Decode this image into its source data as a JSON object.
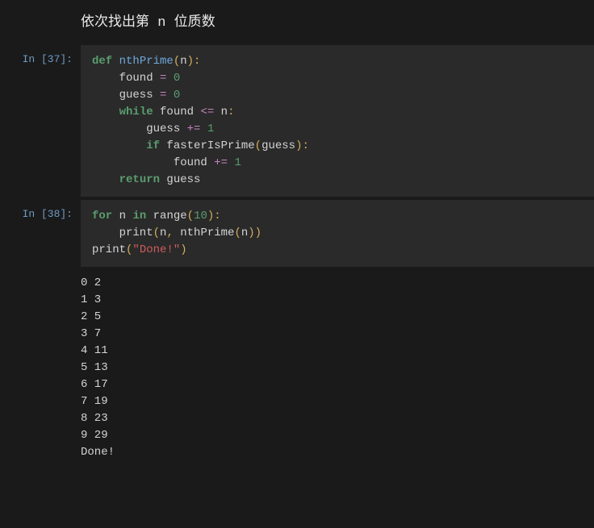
{
  "heading": "依次找出第 n 位质数",
  "cells": [
    {
      "prompt": "In [37]:",
      "code_tokens": [
        {
          "t": "def ",
          "c": "kw"
        },
        {
          "t": "nthPrime",
          "c": "fn"
        },
        {
          "t": "(",
          "c": "paren"
        },
        {
          "t": "n",
          "c": ""
        },
        {
          "t": "):",
          "c": "paren"
        },
        {
          "t": "\n",
          "c": ""
        },
        {
          "t": "    found ",
          "c": ""
        },
        {
          "t": "= ",
          "c": "op"
        },
        {
          "t": "0",
          "c": "num"
        },
        {
          "t": "\n",
          "c": ""
        },
        {
          "t": "    guess ",
          "c": ""
        },
        {
          "t": "= ",
          "c": "op"
        },
        {
          "t": "0",
          "c": "num"
        },
        {
          "t": "\n",
          "c": ""
        },
        {
          "t": "    ",
          "c": ""
        },
        {
          "t": "while",
          "c": "kw"
        },
        {
          "t": " found ",
          "c": ""
        },
        {
          "t": "<= ",
          "c": "op"
        },
        {
          "t": "n",
          "c": ""
        },
        {
          "t": ":",
          "c": "paren"
        },
        {
          "t": "\n",
          "c": ""
        },
        {
          "t": "        guess ",
          "c": ""
        },
        {
          "t": "+= ",
          "c": "op"
        },
        {
          "t": "1",
          "c": "num"
        },
        {
          "t": "\n",
          "c": ""
        },
        {
          "t": "        ",
          "c": ""
        },
        {
          "t": "if",
          "c": "kw"
        },
        {
          "t": " fasterIsPrime",
          "c": ""
        },
        {
          "t": "(",
          "c": "paren"
        },
        {
          "t": "guess",
          "c": ""
        },
        {
          "t": "):",
          "c": "paren"
        },
        {
          "t": "\n",
          "c": ""
        },
        {
          "t": "            found ",
          "c": ""
        },
        {
          "t": "+= ",
          "c": "op"
        },
        {
          "t": "1",
          "c": "num"
        },
        {
          "t": "\n",
          "c": ""
        },
        {
          "t": "    ",
          "c": ""
        },
        {
          "t": "return",
          "c": "kw"
        },
        {
          "t": " guess",
          "c": ""
        }
      ]
    },
    {
      "prompt": "In [38]:",
      "code_tokens": [
        {
          "t": "for",
          "c": "kw"
        },
        {
          "t": " n ",
          "c": ""
        },
        {
          "t": "in",
          "c": "kw"
        },
        {
          "t": " range",
          "c": ""
        },
        {
          "t": "(",
          "c": "paren"
        },
        {
          "t": "10",
          "c": "num"
        },
        {
          "t": "):",
          "c": "paren"
        },
        {
          "t": "\n",
          "c": ""
        },
        {
          "t": "    print",
          "c": ""
        },
        {
          "t": "(",
          "c": "paren"
        },
        {
          "t": "n",
          "c": ""
        },
        {
          "t": ",",
          "c": "paren"
        },
        {
          "t": " nthPrime",
          "c": ""
        },
        {
          "t": "(",
          "c": "paren"
        },
        {
          "t": "n",
          "c": ""
        },
        {
          "t": "))",
          "c": "paren"
        },
        {
          "t": "\n",
          "c": ""
        },
        {
          "t": "print",
          "c": ""
        },
        {
          "t": "(",
          "c": "paren"
        },
        {
          "t": "\"Done!\"",
          "c": "str"
        },
        {
          "t": ")",
          "c": "paren"
        }
      ],
      "output": "0 2\n1 3\n2 5\n3 7\n4 11\n5 13\n6 17\n7 19\n8 23\n9 29\nDone!"
    }
  ]
}
